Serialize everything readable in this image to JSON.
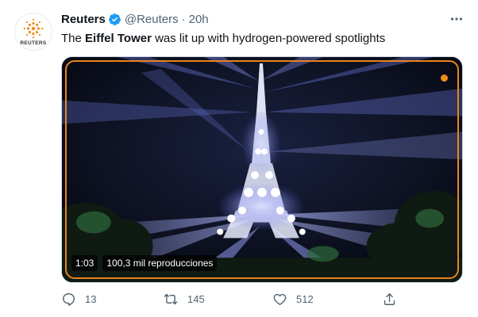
{
  "tweet": {
    "author_name": "Reuters",
    "avatar_wordmark": "REUTERS",
    "handle": "@Reuters",
    "separator": "·",
    "time": "20h",
    "text_before": "The ",
    "text_bold": "Eiffel Tower",
    "text_after": " was lit up with hydrogen-powered spotlights",
    "video": {
      "duration": "1:03",
      "views": "100,3 mil reproducciones"
    },
    "stats": {
      "replies": "13",
      "retweets": "145",
      "likes": "512"
    }
  },
  "colors": {
    "verified_blue": "#1d9bf0",
    "focus_ring": "#e8841c",
    "muted_text": "#536471",
    "beam_blue": "#7f8cff"
  },
  "icons": {
    "avatar": "reuters-logo",
    "verified": "verified-badge-icon",
    "more": "more-icon",
    "reply": "reply-icon",
    "retweet": "retweet-icon",
    "like": "heart-icon",
    "share": "share-icon"
  }
}
